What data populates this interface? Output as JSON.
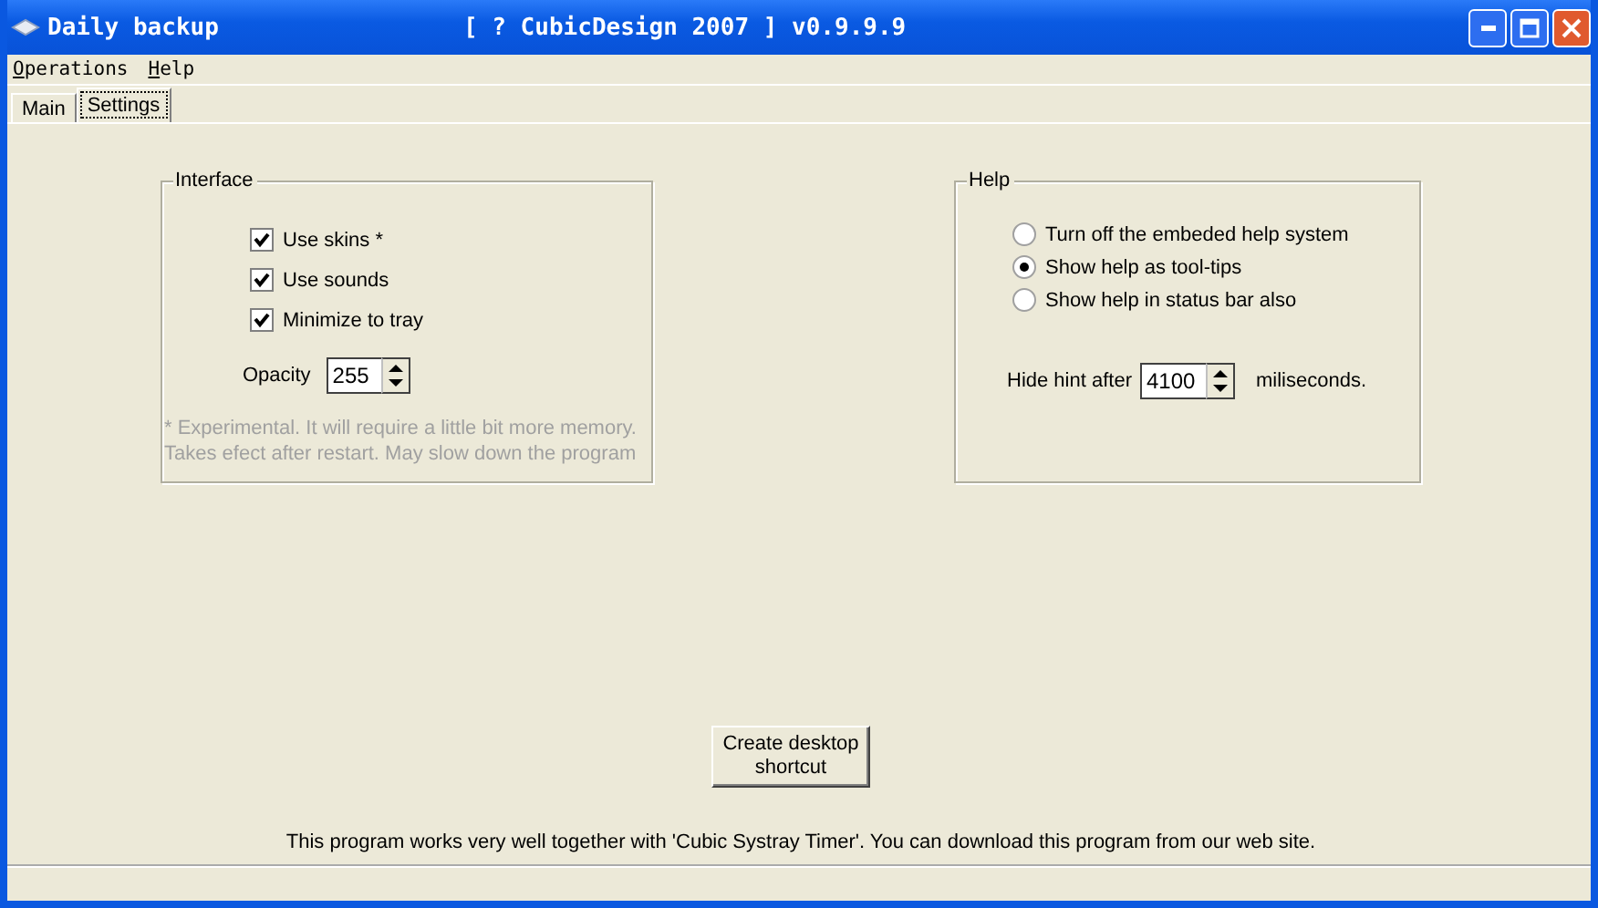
{
  "window": {
    "title": "Daily backup",
    "caption": "[ ? CubicDesign 2007 ] v0.9.9.9"
  },
  "menu": [
    {
      "label": "Operations"
    },
    {
      "label": "Help"
    }
  ],
  "tabs": [
    {
      "label": "Main",
      "selected": false
    },
    {
      "label": "Settings",
      "selected": true
    }
  ],
  "interface": {
    "title": "Interface",
    "options": [
      {
        "label": "Use skins *",
        "checked": true
      },
      {
        "label": "Use sounds",
        "checked": true
      },
      {
        "label": "Minimize to tray",
        "checked": true
      }
    ],
    "opacity": {
      "label": "Opacity",
      "value": "255"
    },
    "note": "* Experimental. It will require a little bit more memory. Takes efect after restart. May slow down the program"
  },
  "help": {
    "title": "Help",
    "options": [
      {
        "label": "Turn off the embeded help system",
        "selected": false
      },
      {
        "label": "Show help as tool-tips",
        "selected": true
      },
      {
        "label": "Show help in status bar also",
        "selected": false
      }
    ],
    "hint": {
      "label": "Hide hint after",
      "value": "4100",
      "unit": "miliseconds."
    }
  },
  "shortcut_button": "Create desktop shortcut",
  "footer": "This program works very well together with 'Cubic Systray Timer'. You can download this program from our web site."
}
